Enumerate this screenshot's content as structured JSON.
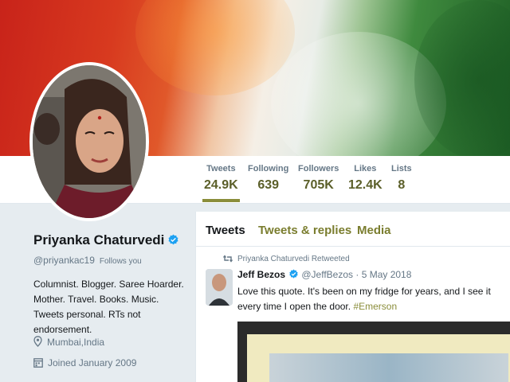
{
  "profile": {
    "name": "Priyanka Chaturvedi",
    "handle": "@priyankac19",
    "follows_you": "Follows you",
    "bio": "Columnist. Blogger. Saree Hoarder. Mother. Travel. Books. Music. Tweets personal. RTs not endorsement.",
    "location": "Mumbai,India",
    "joined": "Joined January 2009",
    "verified_icon": "verified-badge-icon"
  },
  "stats": [
    {
      "label": "Tweets",
      "value": "24.9K"
    },
    {
      "label": "Following",
      "value": "639"
    },
    {
      "label": "Followers",
      "value": "705K"
    },
    {
      "label": "Likes",
      "value": "12.4K"
    },
    {
      "label": "Lists",
      "value": "8"
    }
  ],
  "tabs": [
    {
      "label": "Tweets"
    },
    {
      "label": "Tweets & replies"
    },
    {
      "label": "Media"
    }
  ],
  "tweet": {
    "retweet_line": "Priyanka Chaturvedi Retweeted",
    "author": "Jeff Bezos",
    "handle_date": "@JeffBezos · 5 May 2018",
    "text": "Love this quote. It's been on my fridge for years, and I see it every time I open the door.",
    "hashtag": "#Emerson"
  },
  "colors": {
    "accent": "#8a8d3a",
    "stat_value": "#5b5f29",
    "secondary_text": "#657786",
    "verified": "#1da1f2"
  }
}
